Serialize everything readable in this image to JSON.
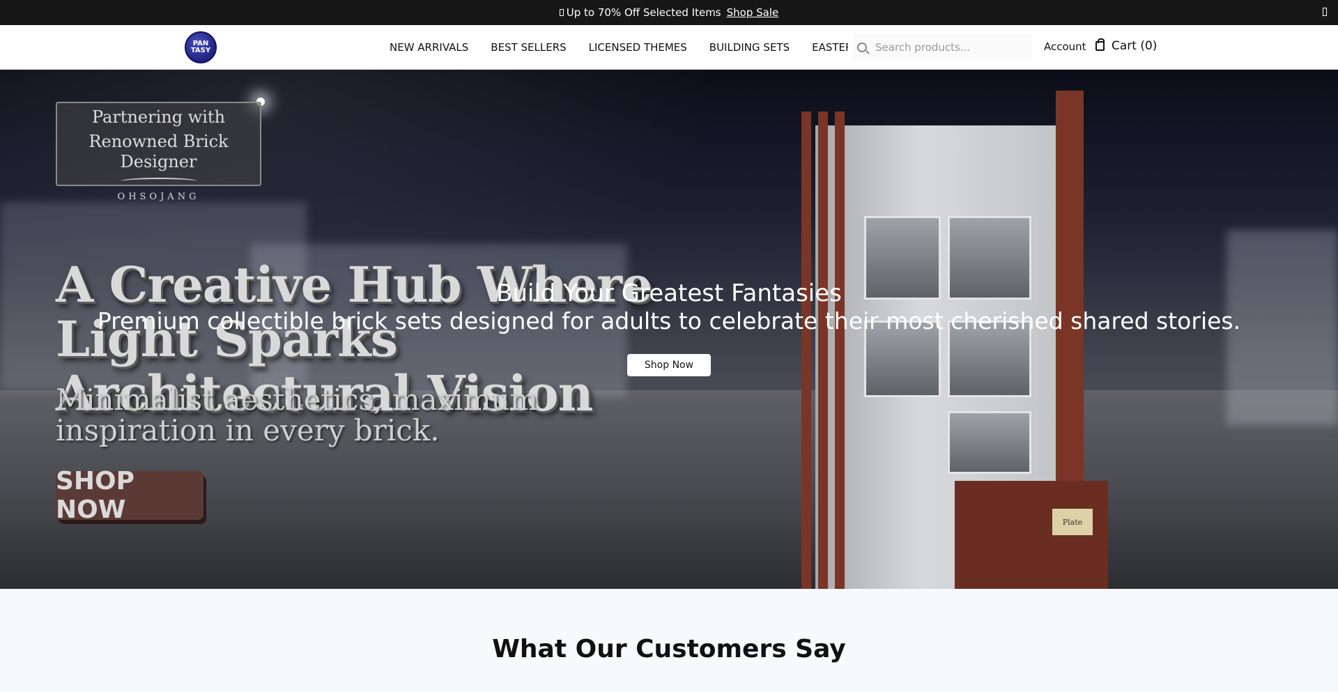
{
  "announcement": {
    "text": "Up to 70% Off Selected Items",
    "link": "Shop Sale",
    "icon": "tag-icon",
    "close_icon": "close-icon"
  },
  "header": {
    "logo_text": "PAN TASY",
    "nav": [
      "NEW ARRIVALS",
      "BEST SELLERS",
      "LICENSED THEMES",
      "BUILDING SETS",
      "EASTERN CU"
    ],
    "search_placeholder": "Search products...",
    "account": "Account",
    "cart": "Cart (0)"
  },
  "hero": {
    "badge": {
      "line1": "Partnering with",
      "line2": "Renowned Brick Designer",
      "brand": "OHSOJANG"
    },
    "banner_title": "A Creative Hub Where Light Sparks Architectural Vision",
    "banner_subtitle": "Minimalist aesthetics, maximum inspiration in every brick.",
    "banner_shop": "SHOP NOW",
    "model_sign": "Plate",
    "title": "Build Your Greatest Fantasies",
    "subtitle": "Premium collectible brick sets designed for adults to celebrate their most cherished shared stories.",
    "button": "Shop Now"
  },
  "testimonials": {
    "heading": "What Our Customers Say"
  },
  "colors": {
    "announcement_bg": "#171717",
    "header_bg": "#ffffff",
    "page_bg": "#f8f9fb",
    "accent_brick": "#7b3526"
  }
}
